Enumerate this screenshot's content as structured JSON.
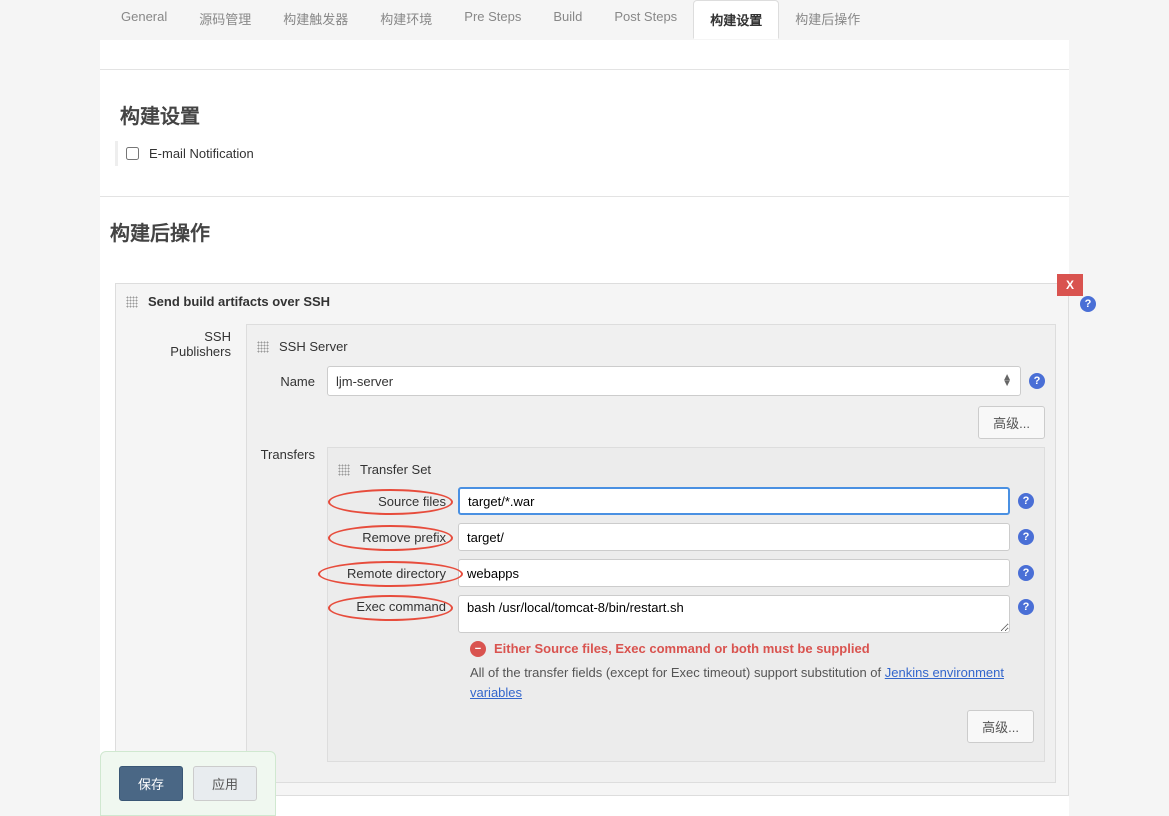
{
  "tabs": [
    {
      "label": "General"
    },
    {
      "label": "源码管理"
    },
    {
      "label": "构建触发器"
    },
    {
      "label": "构建环境"
    },
    {
      "label": "Pre Steps"
    },
    {
      "label": "Build"
    },
    {
      "label": "Post Steps"
    },
    {
      "label": "构建设置",
      "active": true
    },
    {
      "label": "构建后操作"
    }
  ],
  "build_settings": {
    "heading": "构建设置",
    "email_label": "E-mail Notification"
  },
  "post_actions": {
    "heading": "构建后操作",
    "panel_title": "Send build artifacts over SSH",
    "close_x": "X",
    "ssh_publishers_label": "SSH Publishers",
    "ssh_server_label": "SSH Server",
    "name_label": "Name",
    "name_value": "ljm-server",
    "advanced_label": "高级...",
    "transfers_label": "Transfers",
    "transfer_set_label": "Transfer Set",
    "fields": {
      "source_files": {
        "label": "Source files",
        "value": "target/*.war"
      },
      "remove_prefix": {
        "label": "Remove prefix",
        "value": "target/"
      },
      "remote_directory": {
        "label": "Remote directory",
        "value": "webapps"
      },
      "exec_command": {
        "label": "Exec command",
        "value": "bash /usr/local/tomcat-8/bin/restart.sh"
      }
    },
    "error_text": "Either Source files, Exec command or both must be supplied",
    "hint_text_1": "All of the transfer fields (except for Exec timeout) support substitution of ",
    "hint_link": "Jenkins environment variables"
  },
  "footer": {
    "save": "保存",
    "apply": "应用"
  }
}
